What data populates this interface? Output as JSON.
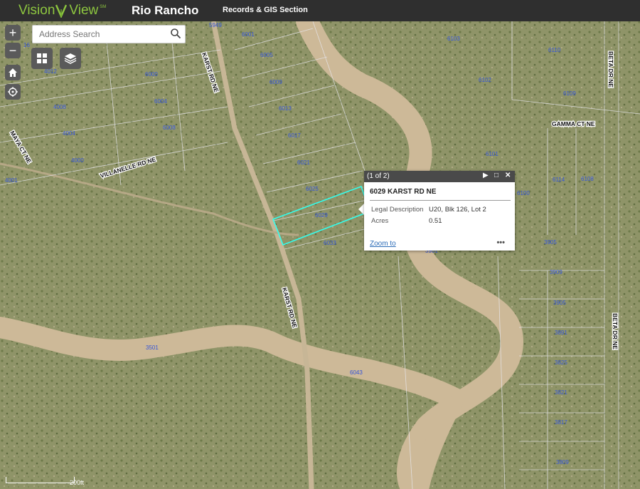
{
  "header": {
    "logo_word1": "Vision",
    "logo_word2": "View",
    "logo_mark": "SM",
    "city": "Rio Rancho",
    "section": "Records & GIS Section"
  },
  "search": {
    "placeholder": "Address Search"
  },
  "controls": {
    "zoom_in": "+",
    "zoom_out": "−",
    "icons": [
      "grid-icon",
      "layers-icon",
      "home-icon",
      "locate-icon"
    ]
  },
  "roads": [
    "KARST RD NE",
    "KARST RD NE",
    "VILLANELLE RD NE",
    "MAYA CT NE",
    "GAMMA CT NE",
    "BETA DR NE",
    "BETA DR NE"
  ],
  "parcels": [
    "5949",
    "6001",
    "6005",
    "6009",
    "6013",
    "6017",
    "6021",
    "6025",
    "6029",
    "6033",
    "6000",
    "6004",
    "6008",
    "4012",
    "4008",
    "4004",
    "4000",
    "4001",
    "16",
    "6103",
    "6110",
    "6102",
    "6109",
    "6101",
    "6100",
    "6114",
    "6108",
    "3905",
    "3901",
    "3909",
    "3905",
    "3891",
    "3825",
    "3821",
    "3817",
    "3809",
    "3501",
    "6043"
  ],
  "popup": {
    "count": "(1 of 2)",
    "title": "6029 KARST RD NE",
    "rows": [
      {
        "label": "Legal Description",
        "value": "U20, Blk 126, Lot 2"
      },
      {
        "label": "Acres",
        "value": "0.51"
      }
    ],
    "zoom_link": "Zoom to",
    "more": "•••"
  },
  "scale": {
    "label": "200ft"
  },
  "colors": {
    "header": "#2f2f2f",
    "brand": "#8dc63f",
    "parcel_label": "#3555d9",
    "highlight": "#33ffee"
  }
}
